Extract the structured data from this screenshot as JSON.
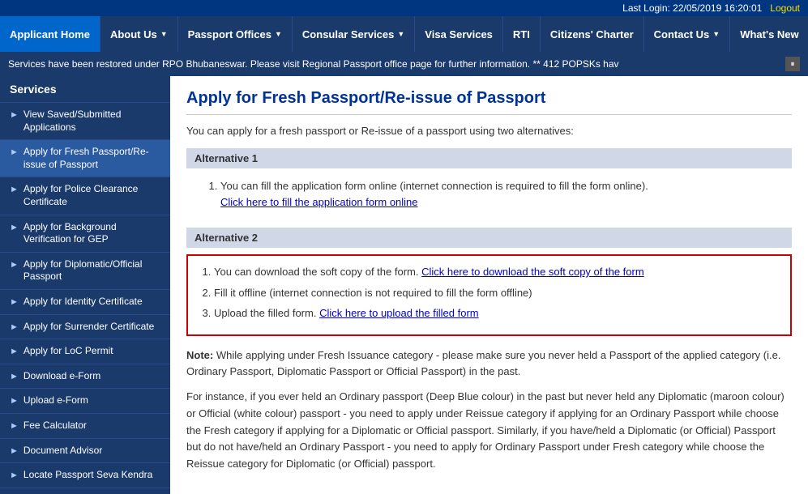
{
  "topbar": {
    "lastlogin_label": "Last Login: 22/05/2019 16:20:01",
    "logout_label": "Logout"
  },
  "navbar": {
    "items": [
      {
        "id": "applicant-home",
        "label": "Applicant Home",
        "has_arrow": false
      },
      {
        "id": "about-us",
        "label": "About Us",
        "has_arrow": true
      },
      {
        "id": "passport-offices",
        "label": "Passport Offices",
        "has_arrow": true
      },
      {
        "id": "consular-services",
        "label": "Consular Services",
        "has_arrow": true
      },
      {
        "id": "visa-services",
        "label": "Visa Services",
        "has_arrow": false
      },
      {
        "id": "rti",
        "label": "RTI",
        "has_arrow": false
      },
      {
        "id": "citizens-charter",
        "label": "Citizens' Charter",
        "has_arrow": false
      },
      {
        "id": "contact-us",
        "label": "Contact Us",
        "has_arrow": true
      },
      {
        "id": "whats-new",
        "label": "What's New",
        "has_arrow": false
      }
    ]
  },
  "ticker": {
    "text": "Services have been restored under RPO Bhubaneswar. Please visit Regional Passport office page for further information. ** 412 POPSKs hav"
  },
  "sidebar": {
    "title": "Services",
    "items": [
      {
        "label": "View Saved/Submitted Applications"
      },
      {
        "label": "Apply for Fresh Passport/Re-issue of Passport",
        "active": true
      },
      {
        "label": "Apply for Police Clearance Certificate"
      },
      {
        "label": "Apply for Background Verification for GEP"
      },
      {
        "label": "Apply for Diplomatic/Official Passport"
      },
      {
        "label": "Apply for Identity Certificate"
      },
      {
        "label": "Apply for Surrender Certificate"
      },
      {
        "label": "Apply for LoC Permit"
      },
      {
        "label": "Download e-Form"
      },
      {
        "label": "Upload e-Form"
      },
      {
        "label": "Fee Calculator"
      },
      {
        "label": "Document Advisor"
      },
      {
        "label": "Locate Passport Seva Kendra"
      }
    ]
  },
  "main": {
    "page_title": "Apply for Fresh Passport/Re-issue of Passport",
    "intro": "You can apply for a fresh passport or Re-issue of a passport using two alternatives:",
    "alt1": {
      "header": "Alternative 1",
      "item1_text": "You can fill the application form online (internet connection is required to fill the form online).",
      "item1_link": "Click here to fill the application form online"
    },
    "alt2": {
      "header": "Alternative 2",
      "item1_text": "You can download the soft copy of the form.",
      "item1_link": "Click here to download the soft copy of the form",
      "item2_text": "Fill it offline (internet connection is not required to fill the form offline)",
      "item3_text": "Upload the filled form.",
      "item3_link": "Click here to upload the filled form"
    },
    "note": {
      "label": "Note:",
      "para1": "While applying under Fresh Issuance category - please make sure you never held a Passport of the applied category (i.e. Ordinary Passport, Diplomatic Passport or Official Passport) in the past.",
      "para2": "For instance, if you ever held an Ordinary passport (Deep Blue colour) in the past but never held any Diplomatic (maroon colour) or Official (white colour) passport - you need to apply under Reissue category if applying for an Ordinary Passport while choose the Fresh category if applying for a Diplomatic or Official passport. Similarly, if you have/held a Diplomatic (or Official) Passport but do not have/held an Ordinary Passport - you need to apply for Ordinary Passport under Fresh category while choose the Reissue category for Diplomatic (or Official) passport."
    }
  }
}
